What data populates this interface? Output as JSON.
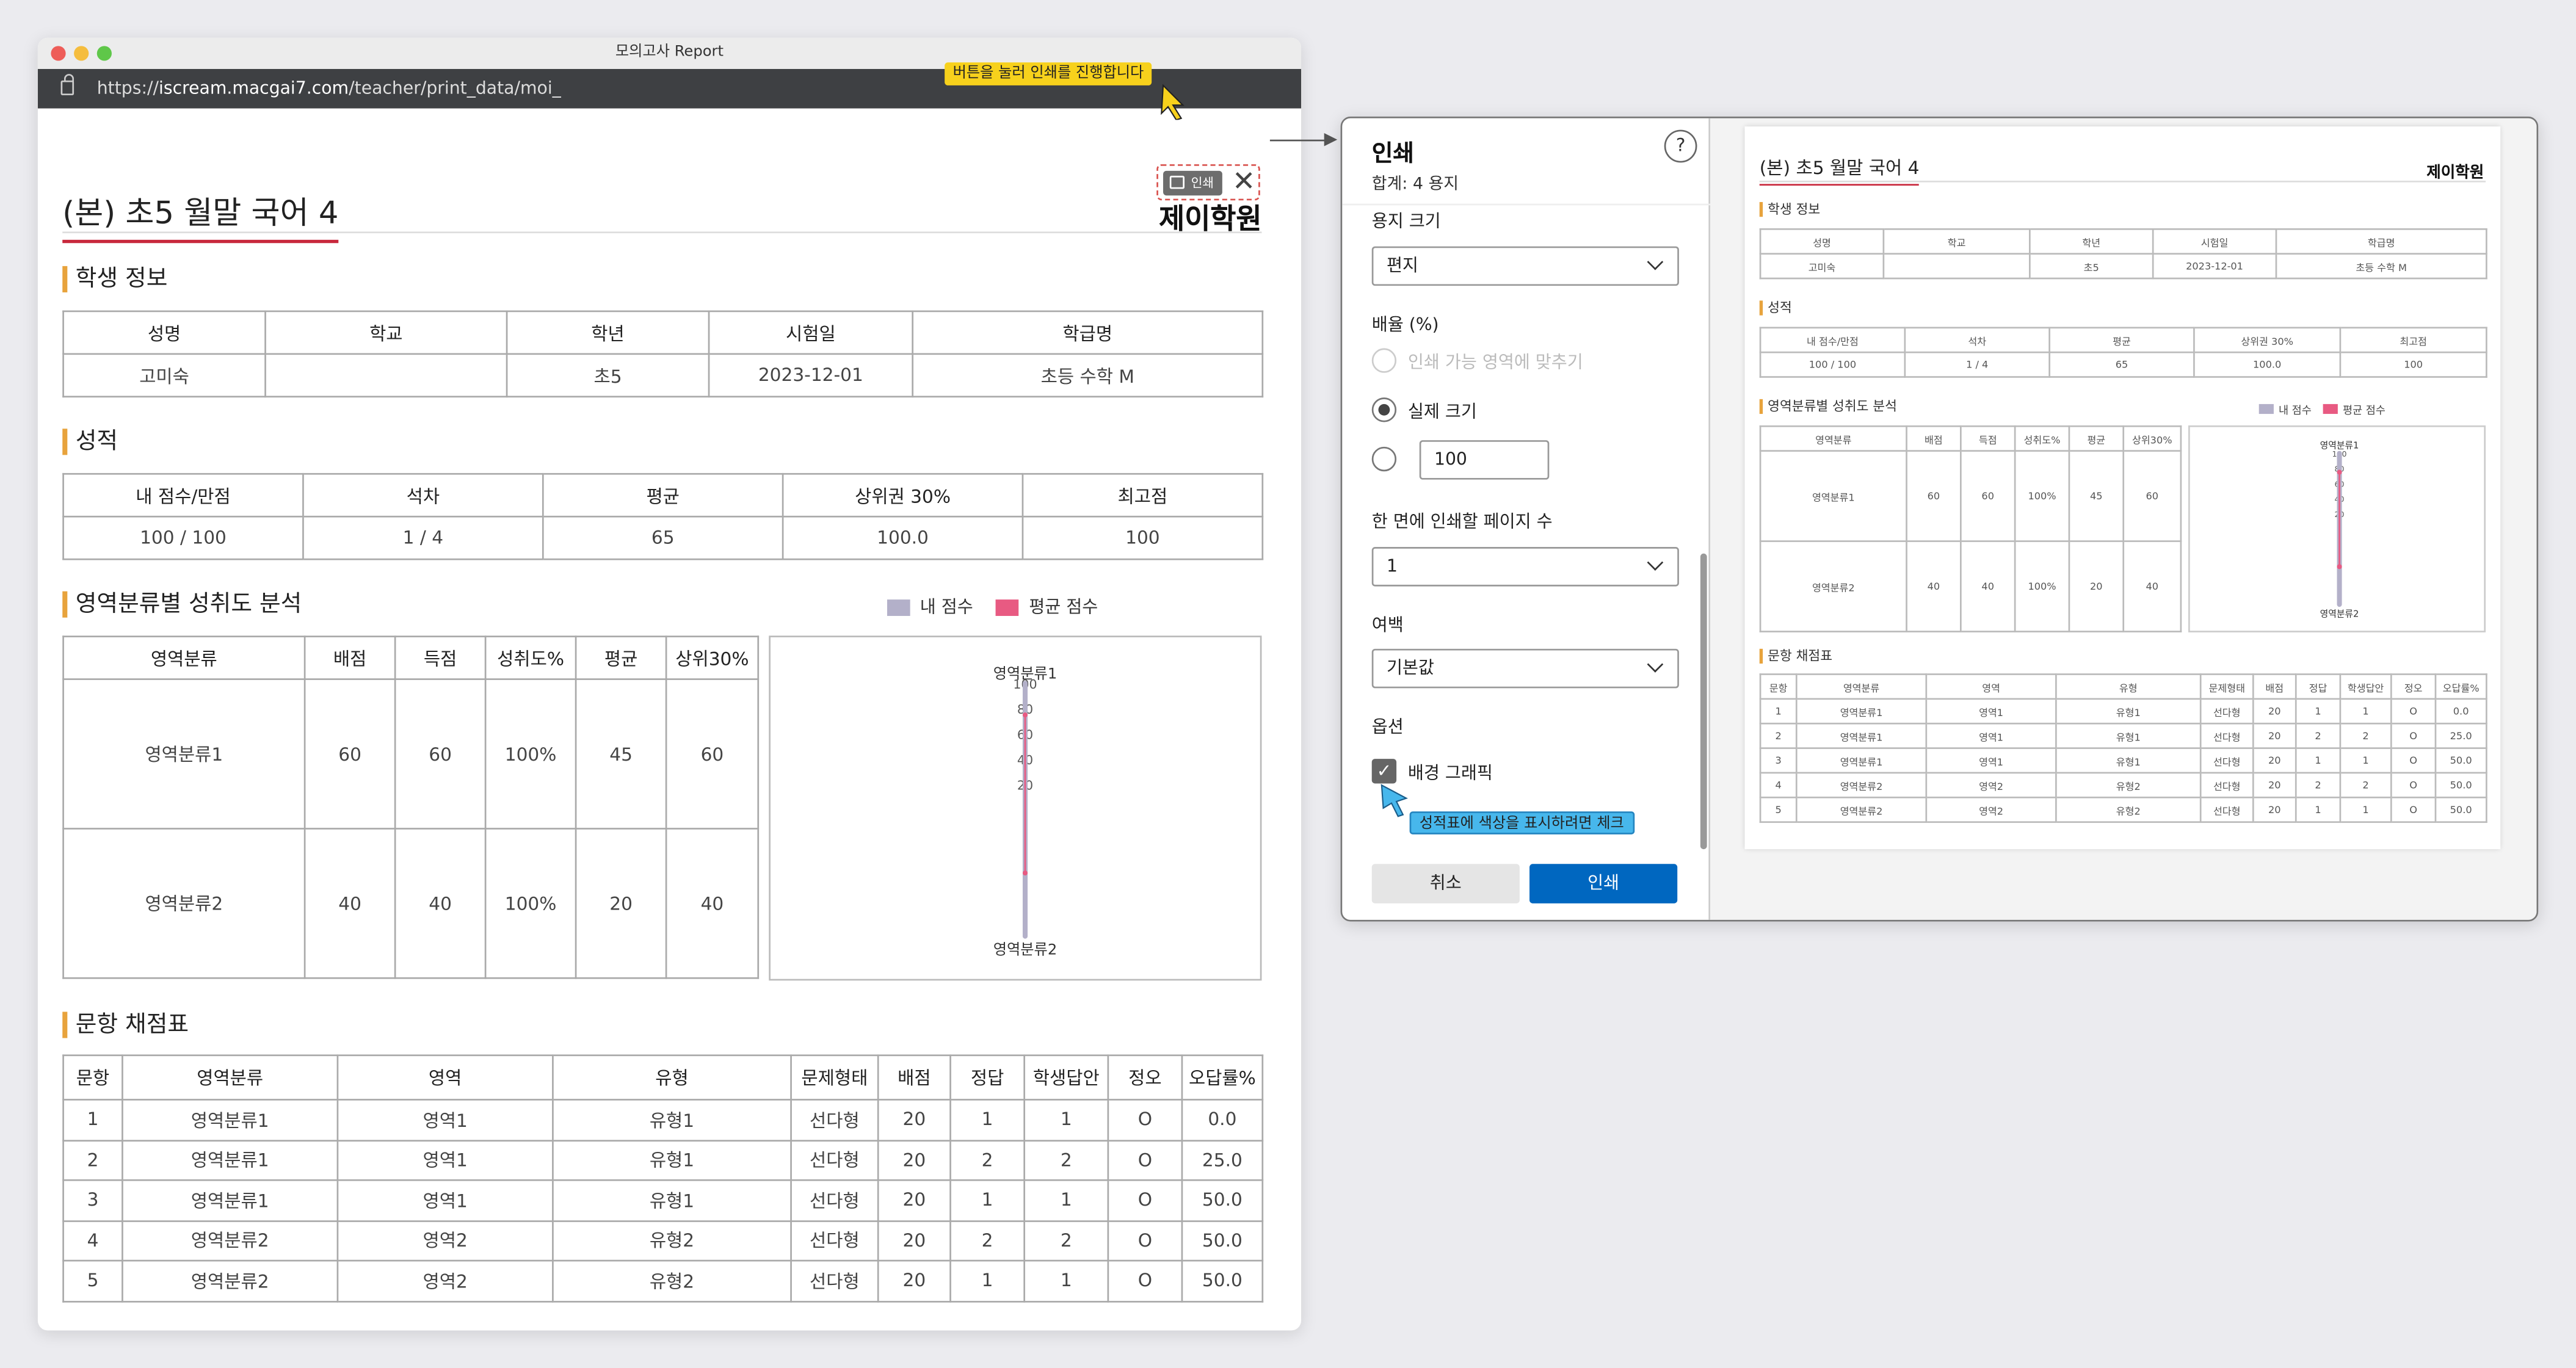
{
  "colors": {
    "accent": "#e8a33c",
    "title_underline": "#c8283c",
    "my_score": "#b3b0c9",
    "avg_score": "#e85a82",
    "print_button": "#0067c0",
    "tooltip_yellow": "#f7d11c",
    "tooltip_blue": "#47b7ec"
  },
  "browser": {
    "window_title": "모의고사 Report",
    "url_prefix": "https://",
    "url_host": "iscream.macgai7.com",
    "url_path": "/teacher/print_data/moi_"
  },
  "tooltips": {
    "print_hint": "버튼을 눌러 인쇄를 진행합니다",
    "color_hint": "성적표에 색상을 표시하려면 체크"
  },
  "report": {
    "title": "(본) 초5 월말 국어 4",
    "academy": "제이학원",
    "print_label": "인쇄",
    "close_icon": "close-icon",
    "student_section": "학생 정보",
    "student_headers": [
      "성명",
      "학교",
      "학년",
      "시험일",
      "학급명"
    ],
    "student_row": [
      "고미숙",
      "",
      "초5",
      "2023-12-01",
      "초등 수학 M"
    ],
    "grade_section": "성적",
    "grade_headers": [
      "내 점수/만점",
      "석차",
      "평균",
      "상위권 30%",
      "최고점"
    ],
    "grade_row": [
      "100 / 100",
      "1 / 4",
      "65",
      "100.0",
      "100"
    ],
    "area_section": "영역분류별 성취도 분석",
    "legend": {
      "mine": "내 점수",
      "avg": "평균 점수"
    },
    "area_headers": [
      "영역분류",
      "배점",
      "득점",
      "성취도%",
      "평균",
      "상위30%"
    ],
    "area_rows": [
      [
        "영역분류1",
        "60",
        "60",
        "100%",
        "45",
        "60"
      ],
      [
        "영역분류2",
        "40",
        "40",
        "100%",
        "20",
        "40"
      ]
    ],
    "item_section": "문항 채점표",
    "item_headers": [
      "문항",
      "영역분류",
      "영역",
      "유형",
      "문제형태",
      "배점",
      "정답",
      "학생답안",
      "정오",
      "오답률%"
    ],
    "item_rows": [
      [
        "1",
        "영역분류1",
        "영역1",
        "유형1",
        "선다형",
        "20",
        "1",
        "1",
        "O",
        "0.0"
      ],
      [
        "2",
        "영역분류1",
        "영역1",
        "유형1",
        "선다형",
        "20",
        "2",
        "2",
        "O",
        "25.0"
      ],
      [
        "3",
        "영역분류1",
        "영역1",
        "유형1",
        "선다형",
        "20",
        "1",
        "1",
        "O",
        "50.0"
      ],
      [
        "4",
        "영역분류2",
        "영역2",
        "유형2",
        "선다형",
        "20",
        "2",
        "2",
        "O",
        "50.0"
      ],
      [
        "5",
        "영역분류2",
        "영역2",
        "유형2",
        "선다형",
        "20",
        "1",
        "1",
        "O",
        "50.0"
      ]
    ]
  },
  "chart_data": {
    "type": "radar",
    "categories": [
      "영역분류1",
      "영역분류2"
    ],
    "tick_labels": [
      "100",
      "80",
      "60",
      "40",
      "20"
    ],
    "rlim": [
      0,
      100
    ],
    "series": [
      {
        "name": "내 점수",
        "values": [
          100,
          100
        ]
      },
      {
        "name": "평균 점수",
        "values": [
          75,
          50
        ]
      }
    ]
  },
  "dialog": {
    "title": "인쇄",
    "subtitle": "합계: 4 용지",
    "help": "?",
    "paper_label": "용지 크기",
    "paper_value": "편지",
    "scale_label": "배율 (%)",
    "scale_fit": "인쇄 가능 영역에 맞추기",
    "scale_actual": "실제 크기",
    "scale_custom_value": "100",
    "pages_label": "한 면에 인쇄할 페이지 수",
    "pages_value": "1",
    "margin_label": "여백",
    "margin_value": "기본값",
    "options_label": "옵션",
    "bg_graphics_label": "배경 그래픽",
    "bg_graphics_checked": true,
    "cancel": "취소",
    "print": "인쇄"
  }
}
